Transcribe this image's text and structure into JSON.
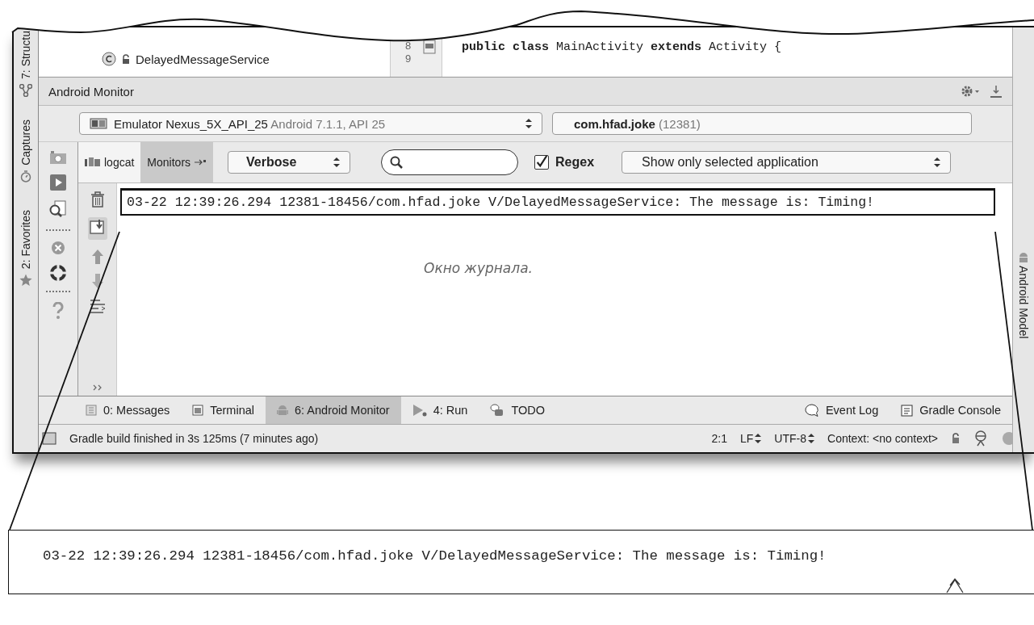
{
  "left_strip": [
    {
      "label": "7: Structu"
    },
    {
      "label": "Captures"
    },
    {
      "label": "2: Favorites"
    }
  ],
  "project_tree": {
    "items": [
      {
        "label": "DelayedMessageService"
      }
    ]
  },
  "editor": {
    "line_numbers": [
      "8",
      "9"
    ],
    "code": "**public class** MainActivity **extends** Activity {"
  },
  "monitor": {
    "title": "Android Monitor",
    "device": {
      "name": "Emulator Nexus_5X_API_25",
      "detail": "Android 7.1.1, API 25"
    },
    "process": {
      "name": "com.hfad.joke",
      "pid": "(12381)"
    }
  },
  "tabs": [
    {
      "label": "logcat",
      "selected": true
    },
    {
      "label": "Monitors",
      "selected": false
    }
  ],
  "log_level": "Verbose",
  "regex": {
    "label": "Regex",
    "checked": true
  },
  "filter": "Show only selected application",
  "log_lines": [
    "03-22 12:39:26.294 12381-18456/com.hfad.joke V/DelayedMessageService: The message is: Timing!"
  ],
  "annotation": "Окно журнала.",
  "tool_tabs": [
    {
      "label": "0: Messages",
      "kind": "messages",
      "selected": false
    },
    {
      "label": "Terminal",
      "kind": "terminal",
      "selected": false
    },
    {
      "label": "6: Android Monitor",
      "kind": "android",
      "selected": true
    },
    {
      "label": "4: Run",
      "kind": "run",
      "selected": false
    },
    {
      "label": "TODO",
      "kind": "todo",
      "selected": false
    },
    {
      "label": "Event Log",
      "kind": "eventlog",
      "selected": false
    },
    {
      "label": "Gradle Console",
      "kind": "console",
      "selected": false
    }
  ],
  "status_bar": {
    "message": "Gradle build finished in 3s 125ms (7 minutes ago)",
    "position": "2:1",
    "line_separator": "LF",
    "encoding": "UTF-8",
    "context": "Context: <no context>"
  },
  "right_strip": {
    "label": "Android Model"
  },
  "callout": {
    "text": "03-22 12:39:26.294 12381-18456/com.hfad.joke V/DelayedMessageService: The message is: Timing!"
  }
}
